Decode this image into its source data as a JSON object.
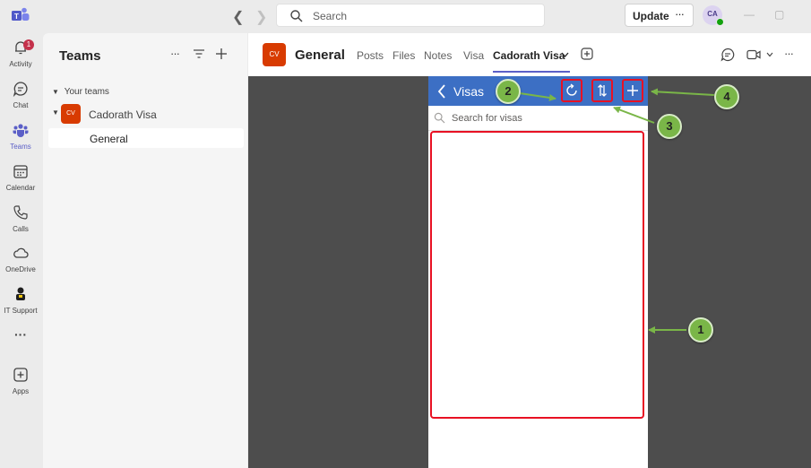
{
  "titlebar": {
    "search_placeholder": "Search",
    "update_label": "Update",
    "update_more": "···",
    "avatar_initials": "CA"
  },
  "rail": {
    "items": [
      {
        "label": "Activity",
        "badge": "1",
        "icon": "bell-icon"
      },
      {
        "label": "Chat",
        "icon": "chat-icon"
      },
      {
        "label": "Teams",
        "icon": "teams-icon",
        "active": true
      },
      {
        "label": "Calendar",
        "icon": "calendar-icon"
      },
      {
        "label": "Calls",
        "icon": "phone-icon"
      },
      {
        "label": "OneDrive",
        "icon": "cloud-icon"
      },
      {
        "label": "IT Support",
        "icon": "it-support-icon"
      },
      {
        "label": "···",
        "icon": "more-icon"
      },
      {
        "label": "Apps",
        "icon": "apps-icon"
      }
    ]
  },
  "panel": {
    "title": "Teams",
    "section": "Your teams",
    "team": {
      "initials": "CV",
      "name": "Cadorath Visa"
    },
    "channel": "General"
  },
  "header": {
    "avatar": "CV",
    "title": "General",
    "tabs": [
      "Posts",
      "Files",
      "Notes",
      "Visa",
      "Cadorath Visa"
    ],
    "active_tab": "Cadorath Visa"
  },
  "app": {
    "title": "Visas",
    "search_placeholder": "Search for visas"
  },
  "callouts": [
    "1",
    "2",
    "3",
    "4"
  ],
  "colors": {
    "accent": "#5b5fc7",
    "app_header": "#3c6fc4",
    "highlight": "#e81123",
    "callout": "#7ab648",
    "team_avatar": "#d83b01"
  }
}
